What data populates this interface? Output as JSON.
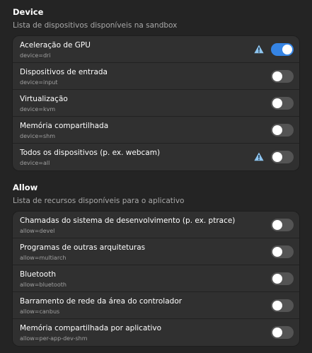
{
  "device": {
    "title": "Device",
    "description": "Lista de dispositivos disponíveis na sandbox",
    "items": [
      {
        "label": "Aceleração de GPU",
        "key": "device=dri",
        "enabled": true,
        "warning": true
      },
      {
        "label": "Dispositivos de entrada",
        "key": "device=input",
        "enabled": false,
        "warning": false
      },
      {
        "label": "Virtualização",
        "key": "device=kvm",
        "enabled": false,
        "warning": false
      },
      {
        "label": "Memória compartilhada",
        "key": "device=shm",
        "enabled": false,
        "warning": false
      },
      {
        "label": "Todos os dispositivos (p. ex. webcam)",
        "key": "device=all",
        "enabled": false,
        "warning": true
      }
    ]
  },
  "allow": {
    "title": "Allow",
    "description": "Lista de recursos disponíveis para o aplicativo",
    "items": [
      {
        "label": "Chamadas do sistema de desenvolvimento (p. ex. ptrace)",
        "key": "allow=devel",
        "enabled": false,
        "warning": false
      },
      {
        "label": "Programas de outras arquiteturas",
        "key": "allow=multiarch",
        "enabled": false,
        "warning": false
      },
      {
        "label": "Bluetooth",
        "key": "allow=bluetooth",
        "enabled": false,
        "warning": false
      },
      {
        "label": "Barramento de rede da área do controlador",
        "key": "allow=canbus",
        "enabled": false,
        "warning": false
      },
      {
        "label": "Memória compartilhada por aplicativo",
        "key": "allow=per-app-dev-shm",
        "enabled": false,
        "warning": false
      }
    ]
  },
  "colors": {
    "accent": "#3584e4",
    "warning_icon": "#8ec5f0",
    "toggle_off": "#545454"
  },
  "icons": {
    "warning": "warning-triangle-icon"
  }
}
